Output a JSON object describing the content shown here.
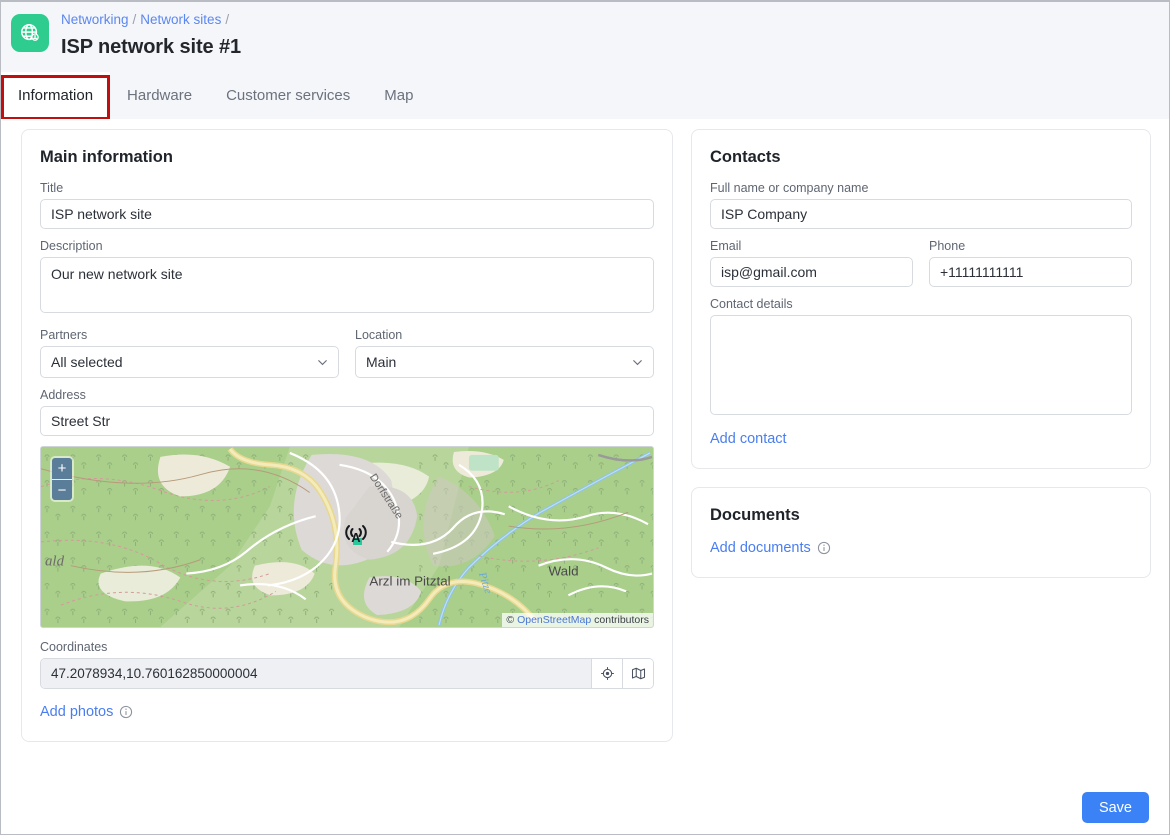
{
  "header": {
    "icon_name": "globe-network-icon",
    "icon_color": "#2ecc8f",
    "breadcrumb": [
      {
        "label": "Networking"
      },
      {
        "label": "Network sites"
      }
    ],
    "breadcrumb_separator": "/",
    "title": "ISP network site #1"
  },
  "tabs": [
    {
      "label": "Information",
      "active": true,
      "annotated": true
    },
    {
      "label": "Hardware",
      "active": false,
      "annotated": false
    },
    {
      "label": "Customer services",
      "active": false,
      "annotated": false
    },
    {
      "label": "Map",
      "active": false,
      "annotated": false
    }
  ],
  "annotation": {
    "color": "#c10e0e"
  },
  "main_information": {
    "title": "Main information",
    "fields": {
      "title": {
        "label": "Title",
        "value": "ISP network site",
        "placeholder": ""
      },
      "description": {
        "label": "Description",
        "value": "Our new network site",
        "placeholder": ""
      },
      "partners": {
        "label": "Partners",
        "value": "All selected"
      },
      "location": {
        "label": "Location",
        "value": "Main"
      },
      "address": {
        "label": "Address",
        "value": "Street Str",
        "placeholder": ""
      },
      "coordinates": {
        "label": "Coordinates",
        "value": "47.2078934,10.760162850000004"
      }
    },
    "map": {
      "zoom_in_label": "+",
      "zoom_out_label": "−",
      "attribution_prefix": "©",
      "attribution_link": "OpenStreetMap",
      "attribution_suffix": "contributors",
      "place_labels": [
        "ald",
        "Dorfstraße",
        "Arzl im Pitztal",
        "Wald",
        "Pitze"
      ],
      "marker_icon": "cell-tower-icon"
    },
    "coordinate_buttons": [
      {
        "icon": "locate-crosshair-icon"
      },
      {
        "icon": "map-fold-icon"
      }
    ],
    "add_photos": {
      "label": "Add photos",
      "info_icon": "info-circle-icon"
    }
  },
  "contacts": {
    "title": "Contacts",
    "fields": {
      "full_name": {
        "label": "Full name or company name",
        "value": "ISP Company"
      },
      "email": {
        "label": "Email",
        "value": "isp@gmail.com"
      },
      "phone": {
        "label": "Phone",
        "value": "+11111111111"
      },
      "contact_details": {
        "label": "Contact details",
        "value": ""
      }
    },
    "add_contact": {
      "label": "Add contact"
    }
  },
  "documents": {
    "title": "Documents",
    "add_documents": {
      "label": "Add documents",
      "info_icon": "info-circle-icon"
    }
  },
  "footer": {
    "save_label": "Save",
    "save_color": "#3b82f6"
  }
}
